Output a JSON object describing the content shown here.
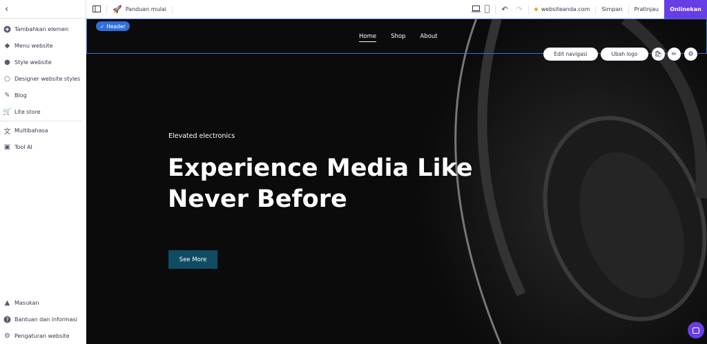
{
  "sidebar": {
    "back_icon": "chevron-left-icon",
    "items": [
      {
        "label": "Tambahkan elemen",
        "icon": "plus-circle-icon"
      },
      {
        "label": "Menu website",
        "icon": "layers-icon"
      },
      {
        "label": "Style website",
        "icon": "palette-icon"
      },
      {
        "label": "Designer website styles",
        "icon": "palette-outline-icon"
      },
      {
        "label": "Blog",
        "icon": "edit-icon"
      },
      {
        "label": "Lite store",
        "icon": "cart-icon"
      },
      {
        "label": "Multibahasa",
        "icon": "translate-icon"
      },
      {
        "label": "Tool AI",
        "icon": "robot-icon"
      }
    ],
    "bottom_items": [
      {
        "label": "Masukan",
        "icon": "megaphone-icon"
      },
      {
        "label": "Bantuan dan informasi",
        "icon": "help-icon"
      },
      {
        "label": "Pengaturan website",
        "icon": "gear-icon"
      }
    ]
  },
  "topbar": {
    "guide_label": "Panduan mulai",
    "domain": "websiteanda.com",
    "save_label": "Simpan",
    "preview_label": "Pratinjau",
    "publish_label": "Onlinekan",
    "accent": "#673de6"
  },
  "canvas": {
    "header_badge": "Header",
    "nav": [
      "Home",
      "Shop",
      "About"
    ],
    "edit_nav_label": "Edit navigasi",
    "change_logo_label": "Ubah logo",
    "hero_subtitle": "Elevated electronics",
    "hero_title": "Experience Media Like Never Before",
    "cta_label": "See More"
  }
}
